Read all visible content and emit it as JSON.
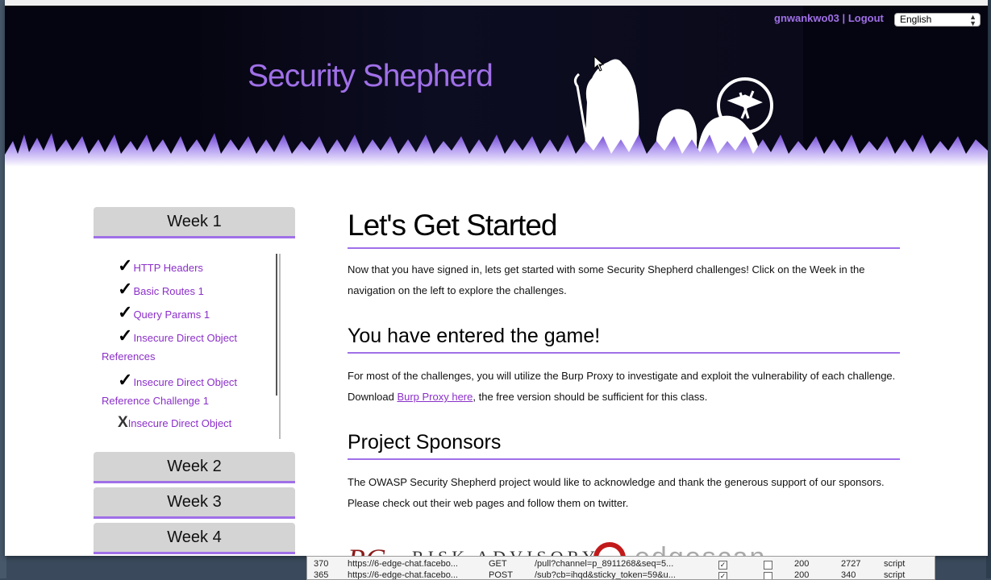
{
  "header": {
    "site_title": "Security Shepherd",
    "username": "gnwankwo03",
    "separator": "|",
    "logout_label": "Logout",
    "language_selected": "English"
  },
  "sidebar": {
    "weeks": [
      {
        "label": "Week 1"
      },
      {
        "label": "Week 2"
      },
      {
        "label": "Week 3"
      },
      {
        "label": "Week 4"
      }
    ],
    "week1_challenges": [
      {
        "mark": "✓",
        "label": "HTTP Headers",
        "status": "completed"
      },
      {
        "mark": "✓",
        "label": "Basic Routes 1",
        "status": "completed"
      },
      {
        "mark": "✓",
        "label": "Query Params 1",
        "status": "completed"
      },
      {
        "mark": "✓",
        "label": "Insecure Direct Object",
        "label2": "References",
        "status": "completed"
      },
      {
        "mark": "✓",
        "label": "Insecure Direct Object",
        "label2": "Reference Challenge 1",
        "status": "completed"
      },
      {
        "mark": "X",
        "label": "Insecure Direct Object",
        "status": "incomplete"
      }
    ]
  },
  "main": {
    "heading": "Let's Get Started",
    "intro": "Now that you have signed in, lets get started with some Security Shepherd challenges! Click on the Week in the navigation on the left to explore the challenges.",
    "section2_heading": "You have entered the game!",
    "section2_text_before": "For most of the challenges, you will utilize the Burp Proxy to investigate and exploit the vulnerability of each challenge. Download ",
    "section2_link": "Burp Proxy here",
    "section2_text_after": ", the free version should be sufficient for this class.",
    "section3_heading": "Project Sponsors",
    "section3_text": "The OWASP Security Shepherd project would like to acknowledge and thank the generous support of our sponsors. Please check out their web pages and follow them on twitter.",
    "sponsors": [
      "RC",
      "RISK ADVISORY",
      "edgescan"
    ]
  },
  "devtools": {
    "rows": [
      {
        "id": "370",
        "url": "https://6-edge-chat.facebo...",
        "method": "GET",
        "path": "/pull?channel=p_8911268&seq=5...",
        "status": "200",
        "size": "2727",
        "type": "script"
      },
      {
        "id": "365",
        "url": "https://6-edge-chat.facebo...",
        "method": "POST",
        "path": "/sub?cb=ihqd&sticky_token=59&u...",
        "status": "200",
        "size": "340",
        "type": "script"
      }
    ]
  },
  "colors": {
    "accent": "#a070e8",
    "link": "#8b2fc9",
    "banner_bg": "#050511",
    "week_button_bg": "#d4d4d4"
  }
}
